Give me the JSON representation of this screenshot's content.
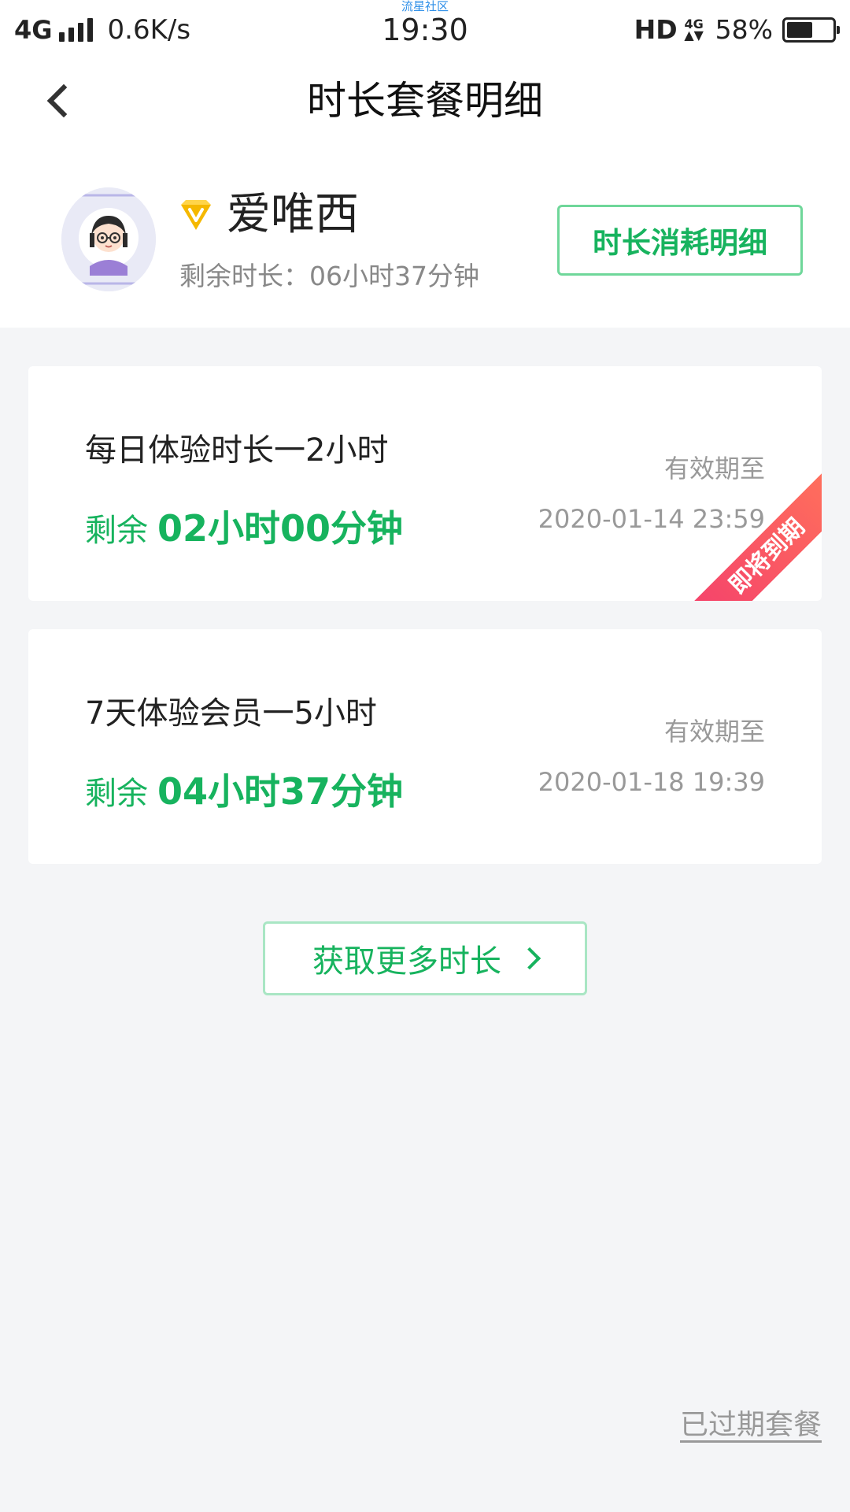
{
  "status_bar": {
    "network": "4G",
    "speed": "0.6K/s",
    "watermark": "流星社区",
    "time": "19:30",
    "hd": "HD",
    "signal_type": "4G",
    "battery": "58%",
    "battery_level": 0.58
  },
  "nav": {
    "title": "时长套餐明细",
    "back_icon": "chevron-left-icon"
  },
  "user": {
    "name": "爱唯西",
    "remaining": "剩余时长：06小时37分钟",
    "consume_button": "时长消耗明细",
    "vip_icon": "vip-diamond-icon",
    "vip_color": "#f5b800"
  },
  "packages": [
    {
      "title": "每日体验时长一2小时",
      "remaining_prefix": "剩余",
      "remaining_value": "02小时00分钟",
      "valid_label": "有效期至",
      "valid_date": "2020-01-14 23:59",
      "badge": "即将到期"
    },
    {
      "title": "7天体验会员一5小时",
      "remaining_prefix": "剩余",
      "remaining_value": "04小时37分钟",
      "valid_label": "有效期至",
      "valid_date": "2020-01-18 19:39"
    }
  ],
  "get_more": "获取更多时长",
  "expired_link": "已过期套餐",
  "colors": {
    "accent_green": "#17b35e",
    "badge_red": "#f4406c"
  }
}
